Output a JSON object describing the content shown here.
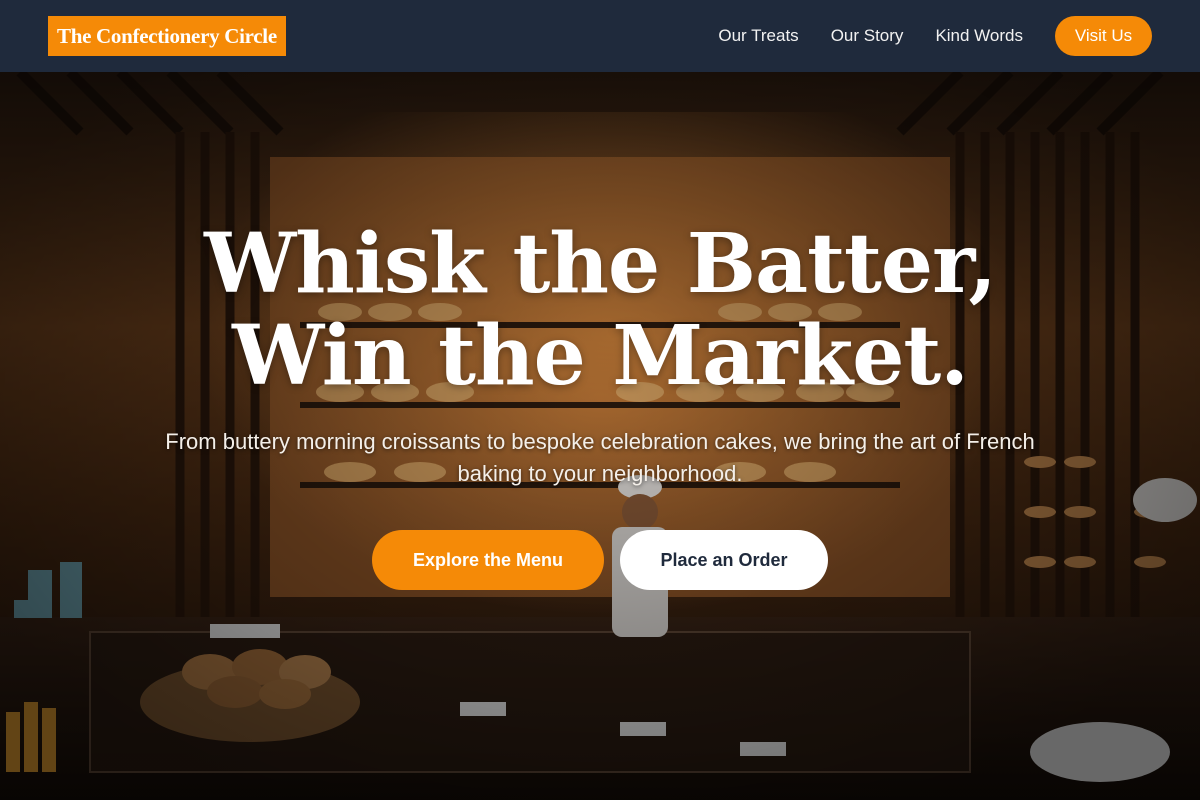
{
  "brand": {
    "name": "The Confectionery Circle",
    "accent": "#f58a07",
    "nav_bg": "#1f2a3c"
  },
  "nav": {
    "links": [
      "Our Treats",
      "Our Story",
      "Kind Words"
    ],
    "cta": "Visit Us"
  },
  "hero": {
    "headline_line1": "Whisk the Batter,",
    "headline_line2": "Win the Market.",
    "subtitle": "From buttery morning croissants to bespoke celebration cakes, we bring the art of French baking to your neighborhood.",
    "primary_button": "Explore the Menu",
    "secondary_button": "Place an Order",
    "background": "bakery-interior-photo"
  }
}
